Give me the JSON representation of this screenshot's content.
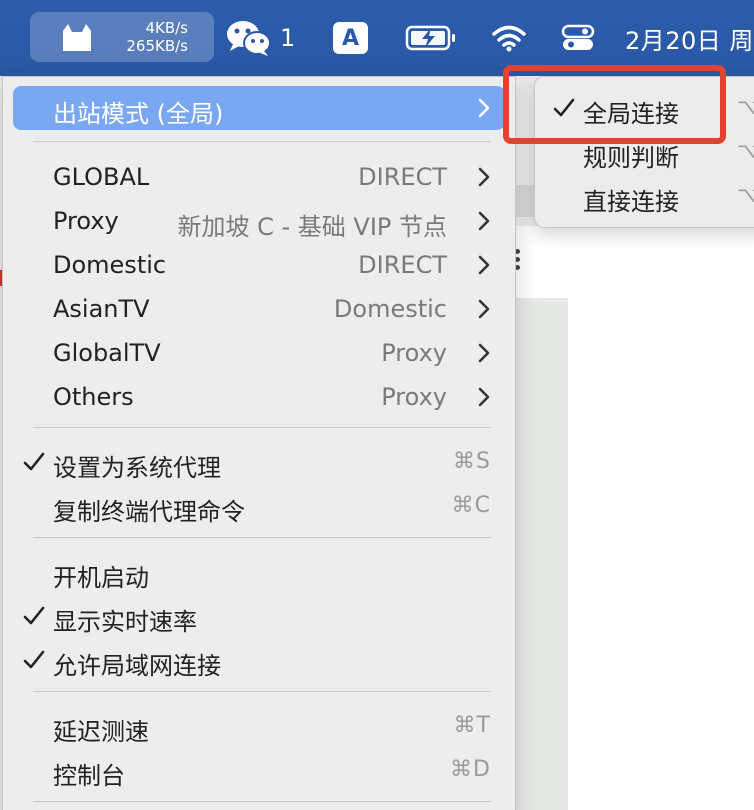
{
  "menubar": {
    "upload_speed": "4KB/s",
    "download_speed": "265KB/s",
    "wechat_badge": "1",
    "input_method": "A",
    "date": "2月20日 周"
  },
  "main_menu": {
    "outbound_mode": {
      "label": "出站模式 (全局)"
    },
    "proxy_groups": [
      {
        "name": "GLOBAL",
        "value": "DIRECT"
      },
      {
        "name": "Proxy",
        "value": "新加坡 C - 基础 VIP 节点"
      },
      {
        "name": "Domestic",
        "value": "DIRECT"
      },
      {
        "name": "AsianTV",
        "value": "Domestic"
      },
      {
        "name": "GlobalTV",
        "value": "Proxy"
      },
      {
        "name": "Others",
        "value": "Proxy"
      }
    ],
    "set_system_proxy": {
      "label": "设置为系统代理",
      "shortcut": "⌘S",
      "checked": true
    },
    "copy_terminal_cmd": {
      "label": "复制终端代理命令",
      "shortcut": "⌘C"
    },
    "launch_at_login": {
      "label": "开机启动",
      "checked": false
    },
    "show_speed": {
      "label": "显示实时速率",
      "checked": true
    },
    "allow_lan": {
      "label": "允许局域网连接",
      "checked": true
    },
    "latency_test": {
      "label": "延迟测速",
      "shortcut": "⌘T"
    },
    "dashboard": {
      "label": "控制台",
      "shortcut": "⌘D"
    }
  },
  "mode_submenu": {
    "items": [
      {
        "label": "全局连接",
        "shortcut": "⌥",
        "checked": true
      },
      {
        "label": "规则判断",
        "shortcut": "⌥",
        "checked": false
      },
      {
        "label": "直接连接",
        "shortcut": "⌥",
        "checked": false
      }
    ]
  },
  "colors": {
    "menubar": "#2a58a6",
    "highlight": "#7aa7f2",
    "annotation_red": "#e2422f"
  }
}
